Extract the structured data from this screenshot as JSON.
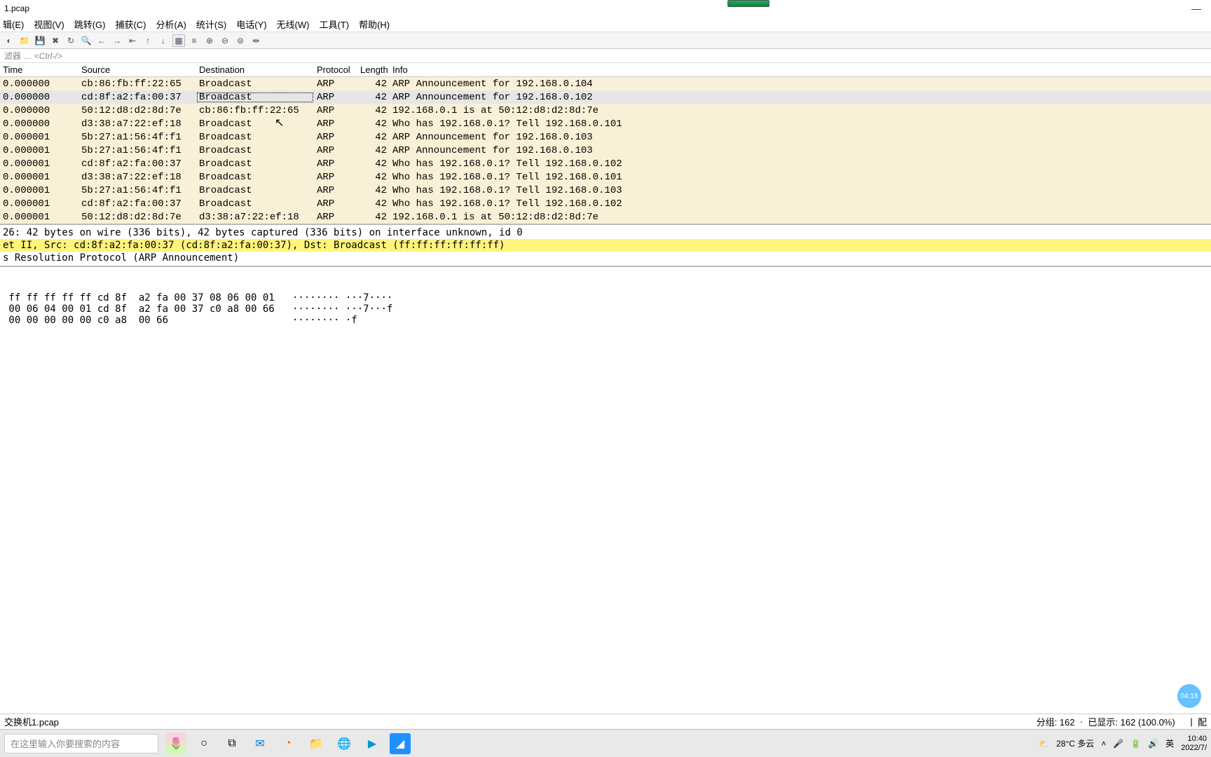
{
  "window": {
    "title": "1.pcap"
  },
  "menu": [
    "辑(E)",
    "视图(V)",
    "跳转(G)",
    "捕获(C)",
    "分析(A)",
    "统计(S)",
    "电话(Y)",
    "无线(W)",
    "工具(T)",
    "帮助(H)"
  ],
  "filter": {
    "label": "滤器 …",
    "hint": "<Ctrl-/>"
  },
  "columns": [
    "Time",
    "Source",
    "Destination",
    "Protocol",
    "Length",
    "Info"
  ],
  "packets": [
    {
      "time": "0.000000",
      "src": "cb:86:fb:ff:22:65",
      "dst": "Broadcast",
      "prot": "ARP",
      "len": "42",
      "info": "ARP Announcement for 192.168.0.104"
    },
    {
      "time": "0.000000",
      "src": "cd:8f:a2:fa:00:37",
      "dst": "Broadcast",
      "prot": "ARP",
      "len": "42",
      "info": "ARP Announcement for 192.168.0.102",
      "selected": true
    },
    {
      "time": "0.000000",
      "src": "50:12:d8:d2:8d:7e",
      "dst": "cb:86:fb:ff:22:65",
      "prot": "ARP",
      "len": "42",
      "info": "192.168.0.1 is at 50:12:d8:d2:8d:7e"
    },
    {
      "time": "0.000000",
      "src": "d3:38:a7:22:ef:18",
      "dst": "Broadcast",
      "prot": "ARP",
      "len": "42",
      "info": "Who has 192.168.0.1? Tell 192.168.0.101"
    },
    {
      "time": "0.000001",
      "src": "5b:27:a1:56:4f:f1",
      "dst": "Broadcast",
      "prot": "ARP",
      "len": "42",
      "info": "ARP Announcement for 192.168.0.103"
    },
    {
      "time": "0.000001",
      "src": "5b:27:a1:56:4f:f1",
      "dst": "Broadcast",
      "prot": "ARP",
      "len": "42",
      "info": "ARP Announcement for 192.168.0.103"
    },
    {
      "time": "0.000001",
      "src": "cd:8f:a2:fa:00:37",
      "dst": "Broadcast",
      "prot": "ARP",
      "len": "42",
      "info": "Who has 192.168.0.1? Tell 192.168.0.102"
    },
    {
      "time": "0.000001",
      "src": "d3:38:a7:22:ef:18",
      "dst": "Broadcast",
      "prot": "ARP",
      "len": "42",
      "info": "Who has 192.168.0.1? Tell 192.168.0.101"
    },
    {
      "time": "0.000001",
      "src": "5b:27:a1:56:4f:f1",
      "dst": "Broadcast",
      "prot": "ARP",
      "len": "42",
      "info": "Who has 192.168.0.1? Tell 192.168.0.103"
    },
    {
      "time": "0.000001",
      "src": "cd:8f:a2:fa:00:37",
      "dst": "Broadcast",
      "prot": "ARP",
      "len": "42",
      "info": "Who has 192.168.0.1? Tell 192.168.0.102"
    },
    {
      "time": "0.000001",
      "src": "50:12:d8:d2:8d:7e",
      "dst": "d3:38:a7:22:ef:18",
      "prot": "ARP",
      "len": "42",
      "info": "192.168.0.1 is at 50:12:d8:d2:8d:7e"
    }
  ],
  "details": [
    {
      "text": "26: 42 bytes on wire (336 bits), 42 bytes captured (336 bits) on interface unknown, id 0",
      "hl": false
    },
    {
      "text": "et II, Src: cd:8f:a2:fa:00:37 (cd:8f:a2:fa:00:37), Dst: Broadcast (ff:ff:ff:ff:ff:ff)",
      "hl": true
    },
    {
      "text": "s Resolution Protocol (ARP Announcement)",
      "hl": false
    }
  ],
  "hex": [
    " ff ff ff ff ff cd 8f  a2 fa 00 37 08 06 00 01   ········ ···7····",
    " 00 06 04 00 01 cd 8f  a2 fa 00 37 c0 a8 00 66   ········ ···7···f",
    " 00 00 00 00 00 c0 a8  00 66                     ········ ·f"
  ],
  "status": {
    "file": "交换机1.pcap",
    "packets": "分组: 162",
    "sep": "·",
    "displayed": "已显示: 162 (100.0%)",
    "profile_prefix": "配"
  },
  "taskbar": {
    "search_placeholder": "在这里输入你要搜索的内容",
    "weather": "28°C 多云",
    "ime": "英",
    "time": "10:40",
    "date": "2022/7/"
  },
  "timer_badge": "04:18"
}
